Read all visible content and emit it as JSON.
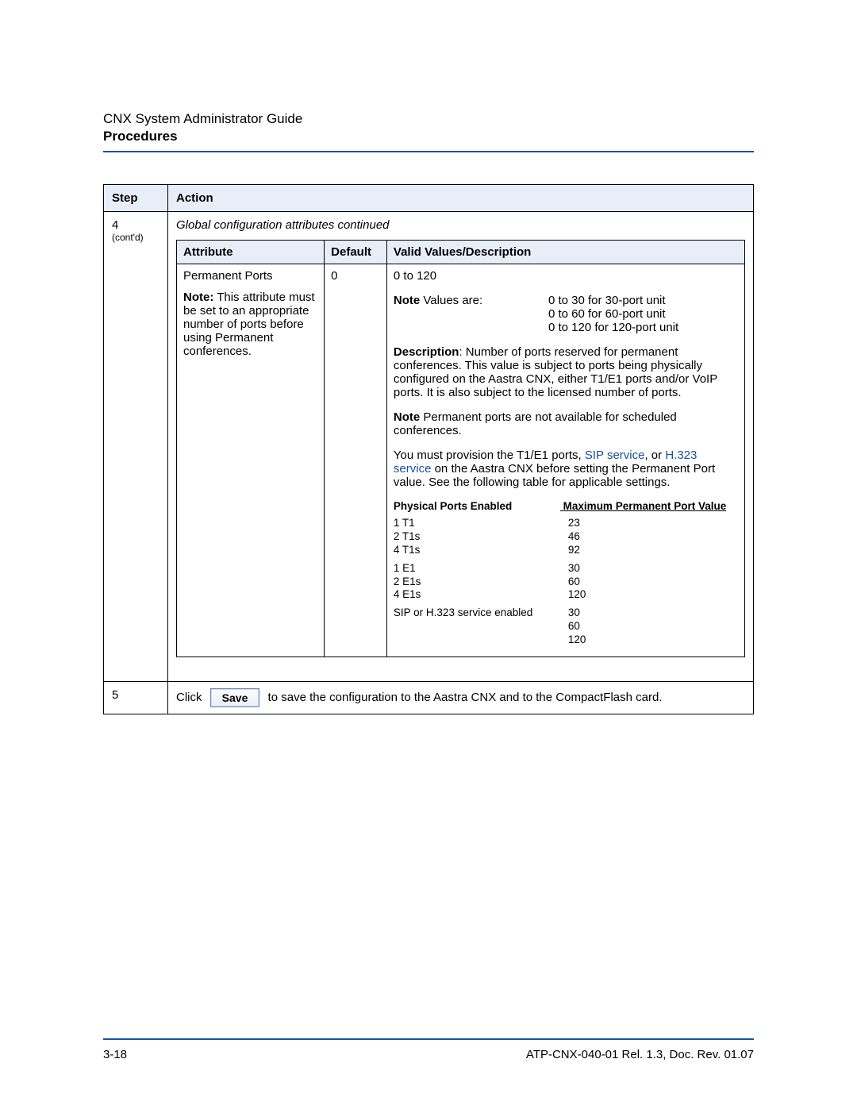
{
  "header": {
    "doc_title": "CNX System Administrator Guide",
    "section": "Procedures"
  },
  "outer_table": {
    "headers": {
      "step": "Step",
      "action": "Action"
    },
    "step4": {
      "num": "4",
      "contd": "(cont'd)",
      "action_title": "Global configuration attributes continued",
      "inner_headers": {
        "attribute": "Attribute",
        "default": "Default",
        "desc": "Valid Values/Description"
      },
      "row": {
        "attribute_name": "Permanent Ports",
        "attribute_note_label": "Note:",
        "attribute_note_text": " This attribute must be set to an appropriate number of ports before using Permanent conferences.",
        "default": "0",
        "range": "0 to 120",
        "values_note_label": "Note",
        "values_note_lead": " Values are:",
        "values_lines": [
          "0 to 30 for 30-port unit",
          "0 to 60 for 60-port unit",
          "0 to 120 for 120-port unit"
        ],
        "desc_label": "Description",
        "desc_text": ": Number of ports reserved for permanent conferences. This value is subject to ports being physically configured on the Aastra CNX, either T1/E1 ports and/or VoIP ports. It is also subject to the licensed number of ports.",
        "note2_label": "Note",
        "note2_text": " Permanent ports are not available for scheduled conferences.",
        "provision_pre": "You must provision the T1/E1 ports, ",
        "provision_link1": "SIP service",
        "provision_mid": ", or ",
        "provision_link2": "H.323 service",
        "provision_post": " on the Aastra CNX before setting the Permanent Port value. See the following table for applicable settings.",
        "subhead_left": "Physical Ports Enabled",
        "subhead_right": "Maximum Permanent Port Value",
        "mini_rows": [
          {
            "left": "1 T1",
            "right": "23"
          },
          {
            "left": "2 T1s",
            "right": "46"
          },
          {
            "left": "4 T1s",
            "right": "92"
          }
        ],
        "mini_rows2": [
          {
            "left": "1 E1",
            "right": "30"
          },
          {
            "left": "2 E1s",
            "right": "60"
          },
          {
            "left": "4 E1s",
            "right": "120"
          }
        ],
        "mini_rows3": [
          {
            "left": "SIP or H.323 service enabled",
            "right": "30"
          },
          {
            "left": "",
            "right": "60"
          },
          {
            "left": "",
            "right": "120"
          }
        ]
      }
    },
    "step5": {
      "num": "5",
      "pre": "Click",
      "button": "Save",
      "post": "to save the configuration to the Aastra CNX and to the CompactFlash card."
    }
  },
  "footer": {
    "page": "3-18",
    "doc_id": "ATP-CNX-040-01 Rel. 1.3, Doc. Rev. 01.07"
  }
}
